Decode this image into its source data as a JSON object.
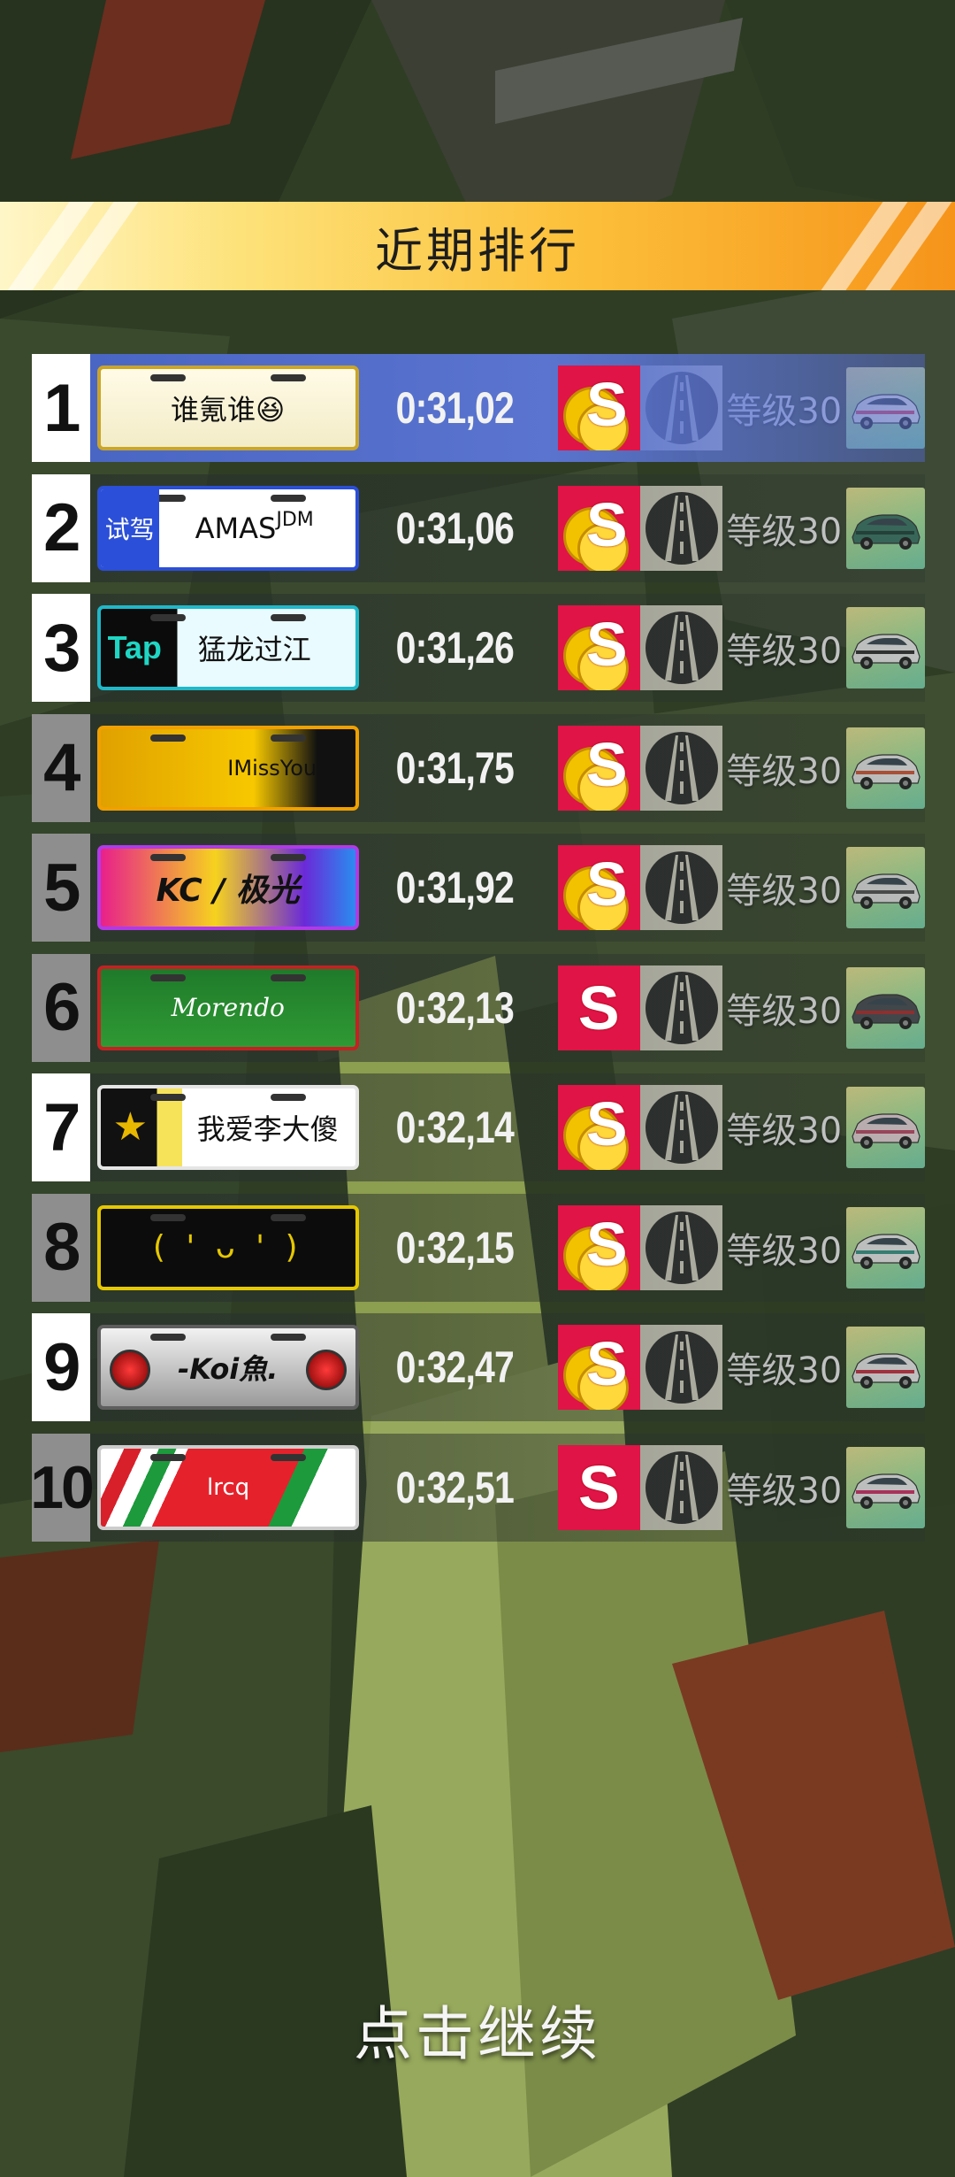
{
  "header": {
    "title": "近期排行"
  },
  "footer": {
    "continue_label": "点击继续"
  },
  "colors": {
    "banner_gradient": [
      "#fff6c8",
      "#f6941a"
    ],
    "highlight_row": "#4a66c4",
    "s_badge": "#e01446"
  },
  "leaderboard": [
    {
      "rank": "1",
      "plate_text": "谁氪谁😆",
      "plate_style": "gold-white",
      "time": "0:31,02",
      "level": "等级30",
      "s_badge_coins": true,
      "car_color": "#f2f2f2",
      "car_accent": "#e14b6a"
    },
    {
      "rank": "2",
      "plate_prefix": "试驾",
      "plate_text": "AMAS",
      "plate_suffix": "JDM",
      "plate_style": "blue-test",
      "time": "0:31,06",
      "level": "等级30",
      "s_badge_coins": true,
      "car_color": "#3d7a68",
      "car_accent": "#22463d"
    },
    {
      "rank": "3",
      "plate_prefix": "Tap",
      "plate_text": "猛龙过江",
      "plate_style": "taptap",
      "time": "0:31,26",
      "level": "等级30",
      "s_badge_coins": true,
      "car_color": "#f5f5f5",
      "car_accent": "#333333"
    },
    {
      "rank": "4",
      "plate_text": "IMissYou",
      "plate_style": "yellow-eye",
      "time": "0:31,75",
      "level": "等级30",
      "s_badge_coins": true,
      "car_color": "#f2f2f2",
      "car_accent": "#d85a3a"
    },
    {
      "rank": "5",
      "plate_text": "KC / 极光",
      "plate_style": "rainbow",
      "time": "0:31,92",
      "level": "等级30",
      "s_badge_coins": true,
      "car_color": "#ececec",
      "car_accent": "#555555"
    },
    {
      "rank": "6",
      "plate_text": "Morendo",
      "plate_style": "green-christmas",
      "time": "0:32,13",
      "level": "等级30",
      "s_badge_coins": false,
      "car_color": "#4b4f55",
      "car_accent": "#b23030"
    },
    {
      "rank": "7",
      "plate_text": "我爱李大傻",
      "plate_style": "police-star",
      "time": "0:32,14",
      "level": "等级30",
      "s_badge_coins": true,
      "car_color": "#f0dce0",
      "car_accent": "#c14d6a"
    },
    {
      "rank": "8",
      "plate_text": "( ' ᴗ ' )",
      "plate_style": "black-yellow",
      "time": "0:32,15",
      "level": "等级30",
      "s_badge_coins": true,
      "car_color": "#f5f5f5",
      "car_accent": "#3a9a8a"
    },
    {
      "rank": "9",
      "plate_text": "-Koi魚.",
      "plate_style": "chrome-lights",
      "time": "0:32,47",
      "level": "等级30",
      "s_badge_coins": true,
      "car_color": "#f3f3f3",
      "car_accent": "#cc3344"
    },
    {
      "rank": "10",
      "plate_text": "lrcq",
      "plate_style": "red-green-stripes",
      "time": "0:32,51",
      "level": "等级30",
      "s_badge_coins": false,
      "car_color": "#f5f5f5",
      "car_accent": "#d6336b"
    }
  ]
}
